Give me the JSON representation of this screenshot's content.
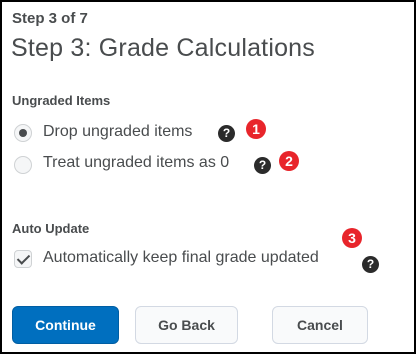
{
  "step": {
    "label": "Step 3 of 7",
    "title": "Step 3: Grade Calculations"
  },
  "ungraded": {
    "heading": "Ungraded Items",
    "options": [
      {
        "label": "Drop ungraded items",
        "selected": true,
        "help_icon": "question-circle-icon",
        "badge": "1"
      },
      {
        "label": "Treat ungraded items as 0",
        "selected": false,
        "help_icon": "question-circle-icon",
        "badge": "2"
      }
    ]
  },
  "auto_update": {
    "heading": "Auto Update",
    "checkbox_label": "Automatically keep final grade updated",
    "checked": true,
    "help_icon": "question-circle-icon",
    "badge": "3"
  },
  "help_glyph": "?",
  "buttons": {
    "continue": "Continue",
    "go_back": "Go Back",
    "cancel": "Cancel"
  },
  "colors": {
    "primary": "#006fbf",
    "badge": "#e8252b",
    "text": "#494c4e"
  }
}
